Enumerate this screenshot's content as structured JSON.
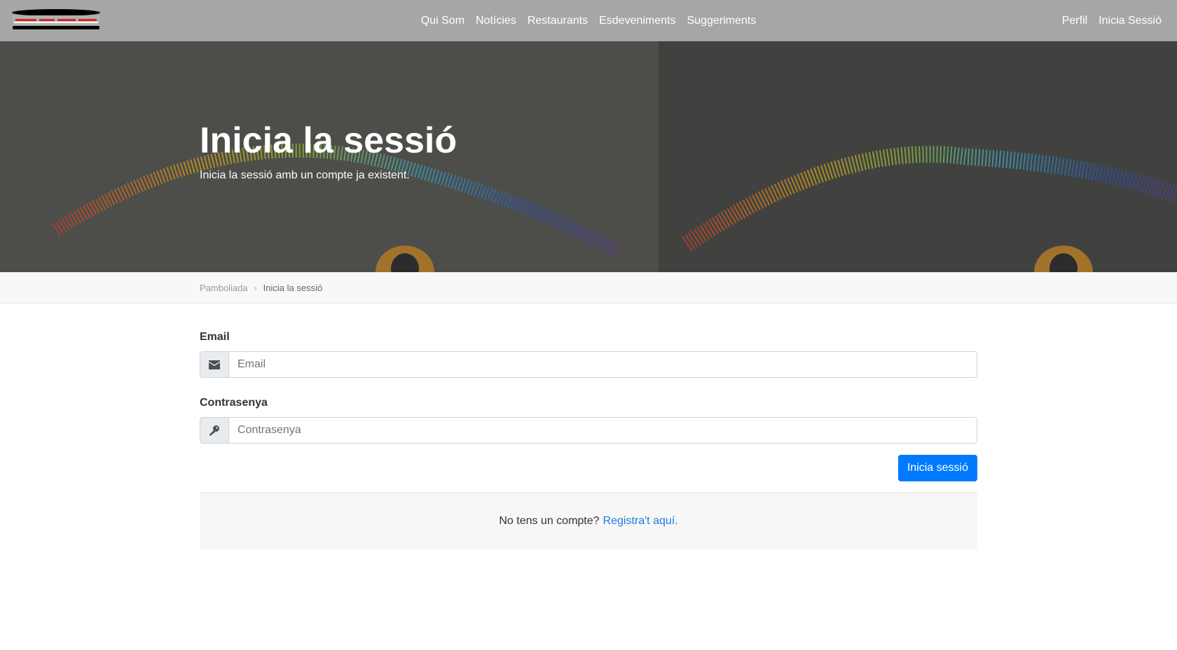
{
  "navbar": {
    "logo_alt": "logo",
    "links": [
      {
        "label": "Qui Som"
      },
      {
        "label": "Notícies"
      },
      {
        "label": "Restaurants"
      },
      {
        "label": "Esdeveniments"
      },
      {
        "label": "Suggeriments"
      }
    ],
    "right_links": [
      {
        "label": "Perfil"
      },
      {
        "label": "Inicia Sessió"
      }
    ]
  },
  "hero": {
    "title": "Inicia la sessió",
    "subtitle": "Inicia la sessió amb un compte ja existent."
  },
  "breadcrumb": {
    "home": "Pamboliada",
    "separator": "›",
    "current": "Inicia la sessió"
  },
  "form": {
    "email": {
      "label": "Email",
      "placeholder": "Email",
      "icon": "envelope-icon"
    },
    "password": {
      "label": "Contrasenya",
      "placeholder": "Contrasenya",
      "icon": "key-icon"
    },
    "submit_label": "Inicia sessió"
  },
  "register": {
    "prompt": "No tens un compte?",
    "link": "Registra't aquí."
  },
  "colors": {
    "navbar": "#a6a6a6",
    "primary": "#007bff",
    "link": "#1a7fe0"
  }
}
